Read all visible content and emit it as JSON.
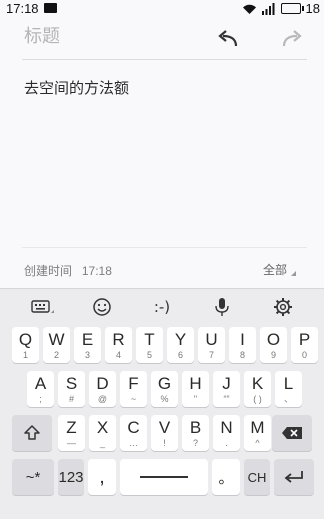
{
  "status_bar": {
    "time": "17:18",
    "battery": "18"
  },
  "note": {
    "title_placeholder": "标题",
    "content": "去空间的方法额",
    "created_label": "创建时间",
    "created_time": "17:18",
    "folder": "全部"
  },
  "keyboard": {
    "toolbar": [
      "keyboard-icon",
      "emoji-icon",
      "emoticon-icon",
      "mic-icon",
      "settings-icon"
    ],
    "emoticon_text": ":-)",
    "row1": [
      {
        "m": "Q",
        "s": "1"
      },
      {
        "m": "W",
        "s": "2"
      },
      {
        "m": "E",
        "s": "3"
      },
      {
        "m": "R",
        "s": "4"
      },
      {
        "m": "T",
        "s": "5"
      },
      {
        "m": "Y",
        "s": "6"
      },
      {
        "m": "U",
        "s": "7"
      },
      {
        "m": "I",
        "s": "8"
      },
      {
        "m": "O",
        "s": "9"
      },
      {
        "m": "P",
        "s": "0"
      }
    ],
    "row2": [
      {
        "m": "A",
        "s": ";"
      },
      {
        "m": "S",
        "s": "#"
      },
      {
        "m": "D",
        "s": "@"
      },
      {
        "m": "F",
        "s": "~"
      },
      {
        "m": "G",
        "s": "%"
      },
      {
        "m": "H",
        "s": "\""
      },
      {
        "m": "J",
        "s": "“”"
      },
      {
        "m": "K",
        "s": "( )"
      },
      {
        "m": "L",
        "s": "、"
      }
    ],
    "row3": [
      {
        "m": "Z",
        "s": "—"
      },
      {
        "m": "X",
        "s": "_"
      },
      {
        "m": "C",
        "s": "…"
      },
      {
        "m": "V",
        "s": "!"
      },
      {
        "m": "B",
        "s": "?"
      },
      {
        "m": "N",
        "s": "."
      },
      {
        "m": "M",
        "s": "^"
      }
    ],
    "symbols_label": "~*",
    "numbers_label": "123",
    "comma_label": ",",
    "period_label": "。",
    "lang_label": "CH"
  }
}
